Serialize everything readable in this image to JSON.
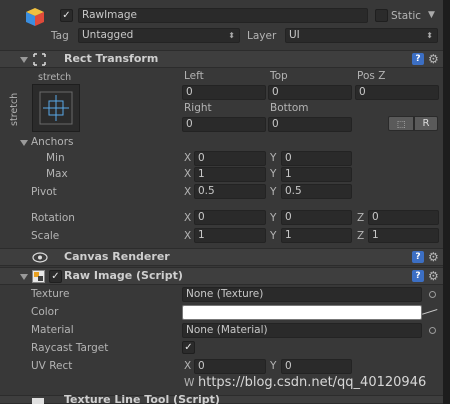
{
  "object": {
    "name": "RawImage",
    "static_label": "Static",
    "tag_label": "Tag",
    "tag_value": "Untagged",
    "layer_label": "Layer",
    "layer_value": "UI"
  },
  "rect_transform": {
    "title": "Rect Transform",
    "stretch_top": "stretch",
    "stretch_side": "stretch",
    "left_label": "Left",
    "top_label": "Top",
    "posz_label": "Pos Z",
    "left_value": "0",
    "top_value": "0",
    "posz_value": "0",
    "right_label": "Right",
    "bottom_label": "Bottom",
    "right_value": "0",
    "bottom_value": "0",
    "r_button": "R",
    "anchors_label": "Anchors",
    "min_label": "Min",
    "max_label": "Max",
    "min_x": "0",
    "min_y": "0",
    "max_x": "1",
    "max_y": "1",
    "pivot_label": "Pivot",
    "pivot_x": "0.5",
    "pivot_y": "0.5",
    "rotation_label": "Rotation",
    "rot_x": "0",
    "rot_y": "0",
    "rot_z": "0",
    "scale_label": "Scale",
    "scale_x": "1",
    "scale_y": "1",
    "scale_z": "1",
    "x": "X",
    "y": "Y",
    "z": "Z"
  },
  "canvas_renderer": {
    "title": "Canvas Renderer"
  },
  "raw_image": {
    "title": "Raw Image (Script)",
    "texture_label": "Texture",
    "texture_value": "None (Texture)",
    "color_label": "Color",
    "color_value": "#ffffff",
    "material_label": "Material",
    "material_value": "None (Material)",
    "raycast_label": "Raycast Target",
    "uvrect_label": "UV Rect",
    "uv_x": "0",
    "uv_y": "0",
    "w_label": "W"
  },
  "next_component": {
    "title": "Texture Line Tool (Script)"
  },
  "watermark": "https://blog.csdn.net/qq_40120946"
}
